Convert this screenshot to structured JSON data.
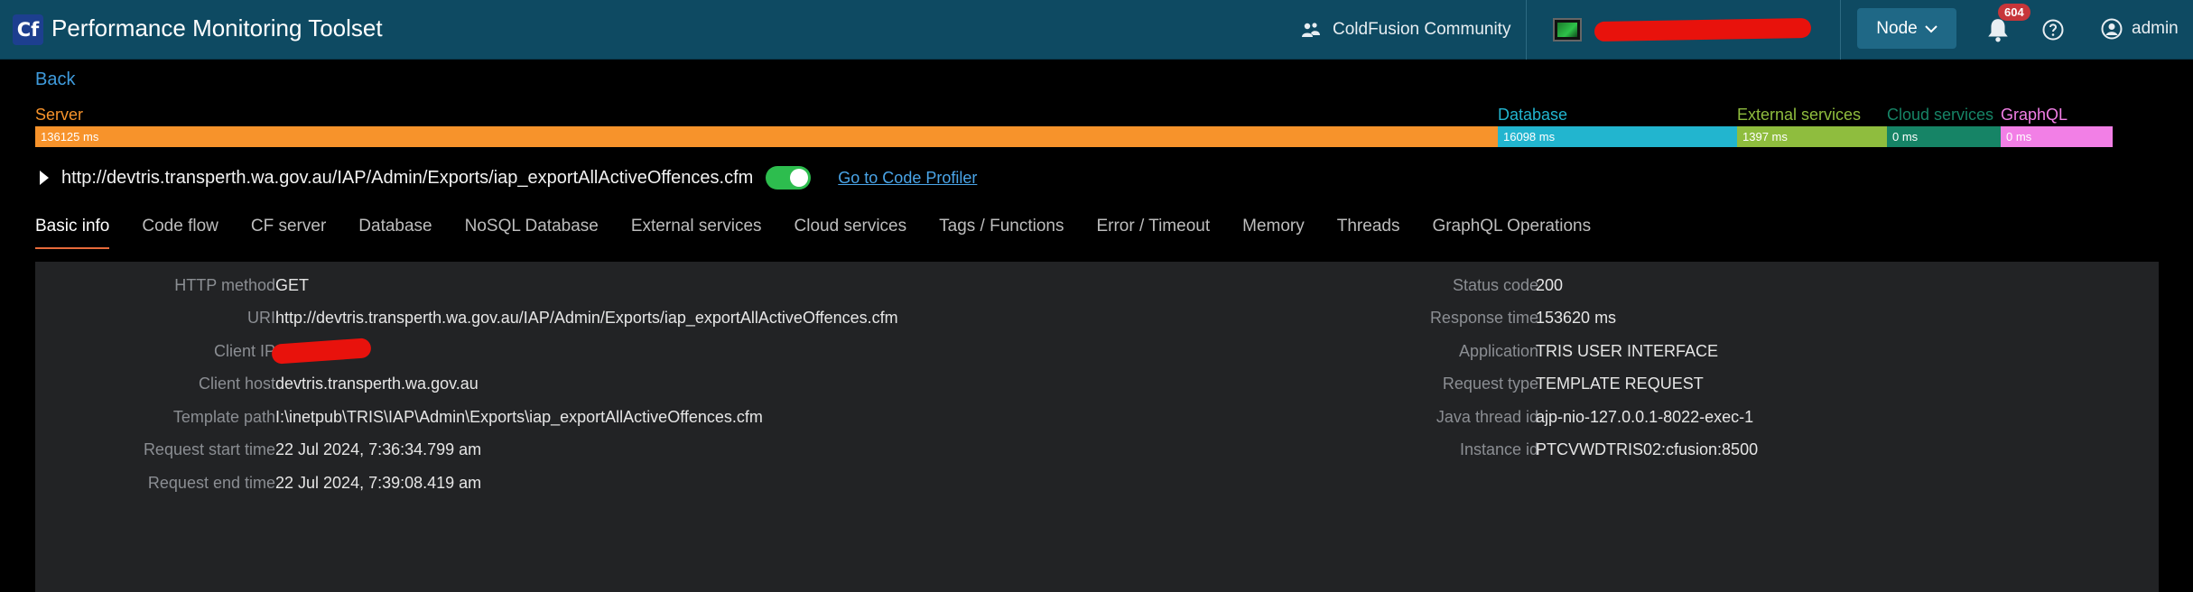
{
  "header": {
    "logo_text": "Cf",
    "title": "Performance Monitoring Toolset",
    "community_label": "ColdFusion Community",
    "node_label": "Node",
    "notification_count": "604",
    "user_label": "admin"
  },
  "back_label": "Back",
  "breakdown": [
    {
      "label": "Server",
      "value": "136125 ms",
      "color": "#f7932b",
      "label_color": "#f7932b"
    },
    {
      "label": "Database",
      "value": "16098 ms",
      "color": "#22b5cf",
      "label_color": "#22b5cf"
    },
    {
      "label": "External services",
      "value": "1397 ms",
      "color": "#8fbd3e",
      "label_color": "#8fbd3e"
    },
    {
      "label": "Cloud services",
      "value": "0 ms",
      "color": "#168466",
      "label_color": "#168466"
    },
    {
      "label": "GraphQL",
      "value": "0 ms",
      "color": "#f27fe6",
      "label_color": "#f27fe6"
    }
  ],
  "request": {
    "url": "http://devtris.transperth.wa.gov.au/IAP/Admin/Exports/iap_exportAllActiveOffences.cfm",
    "profiler_link": "Go to Code Profiler"
  },
  "tabs": [
    "Basic info",
    "Code flow",
    "CF server",
    "Database",
    "NoSQL Database",
    "External services",
    "Cloud services",
    "Tags / Functions",
    "Error / Timeout",
    "Memory",
    "Threads",
    "GraphQL Operations"
  ],
  "basic_info": {
    "left": [
      {
        "label": "HTTP method",
        "value": "GET"
      },
      {
        "label": "URI",
        "value": "http://devtris.transperth.wa.gov.au/IAP/Admin/Exports/iap_exportAllActiveOffences.cfm"
      },
      {
        "label": "Client IP",
        "value": ""
      },
      {
        "label": "Client host",
        "value": "devtris.transperth.wa.gov.au"
      },
      {
        "label": "Template path",
        "value": "I:\\inetpub\\TRIS\\IAP\\Admin\\Exports\\iap_exportAllActiveOffences.cfm"
      },
      {
        "label": "Request start time",
        "value": "22 Jul 2024, 7:36:34.799 am"
      },
      {
        "label": "Request end time",
        "value": "22 Jul 2024, 7:39:08.419 am"
      }
    ],
    "right": [
      {
        "label": "Status code",
        "value": "200"
      },
      {
        "label": "Response time",
        "value": "153620 ms"
      },
      {
        "label": "Application",
        "value": "TRIS USER INTERFACE"
      },
      {
        "label": "Request type",
        "value": "TEMPLATE REQUEST"
      },
      {
        "label": "Java thread id",
        "value": "ajp-nio-127.0.0.1-8022-exec-1"
      },
      {
        "label": "Instance id",
        "value": "PTCVWDTRIS02:cfusion:8500"
      }
    ]
  }
}
